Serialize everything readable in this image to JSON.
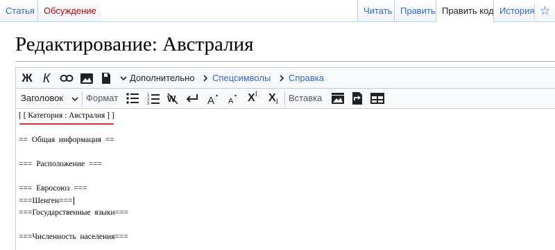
{
  "tabs": {
    "left": [
      {
        "label": "Статья"
      },
      {
        "label": "Обсуждение"
      }
    ],
    "right": [
      {
        "label": "Читать"
      },
      {
        "label": "Править"
      },
      {
        "label": "Править код"
      },
      {
        "label": "История"
      }
    ],
    "selected": "Править код",
    "star_icon": "☆"
  },
  "page": {
    "title": "Редактирование: Австралия"
  },
  "toolbar": {
    "bold_label": "Ж",
    "italic_label": "К",
    "advanced_label": "Дополнительно",
    "special_chars_label": "Спецсимволы",
    "help_label": "Справка",
    "heading_label": "Заголовок",
    "format_label": "Формат",
    "insert_label": "Вставка",
    "superscript_label": "X",
    "superscript_mark": "I",
    "subscript_label": "X",
    "subscript_mark": "I"
  },
  "editor": {
    "lines": [
      "[ [ Категория : Австралия ] ]",
      "",
      "==  Общая  информация  ==",
      "",
      "===  Расположение  ===",
      "",
      "===  Евросоюз  ===",
      "===Шенген===",
      "===Государственные  языки===",
      "",
      "===Численность  населения==="
    ]
  },
  "colors": {
    "link": "#3366cc",
    "new_link": "#ba0000",
    "toolbar_bg": "#f8f9fa",
    "border": "#c8ccd1",
    "underline": "#dd3333"
  },
  "icons": [
    "link-icon",
    "image-icon",
    "save-icon",
    "bullet-list-icon",
    "numbered-list-icon",
    "nowiki-icon",
    "newline-icon",
    "big-text-icon",
    "small-text-icon",
    "gallery-icon",
    "redirect-icon",
    "table-icon",
    "star-icon"
  ]
}
